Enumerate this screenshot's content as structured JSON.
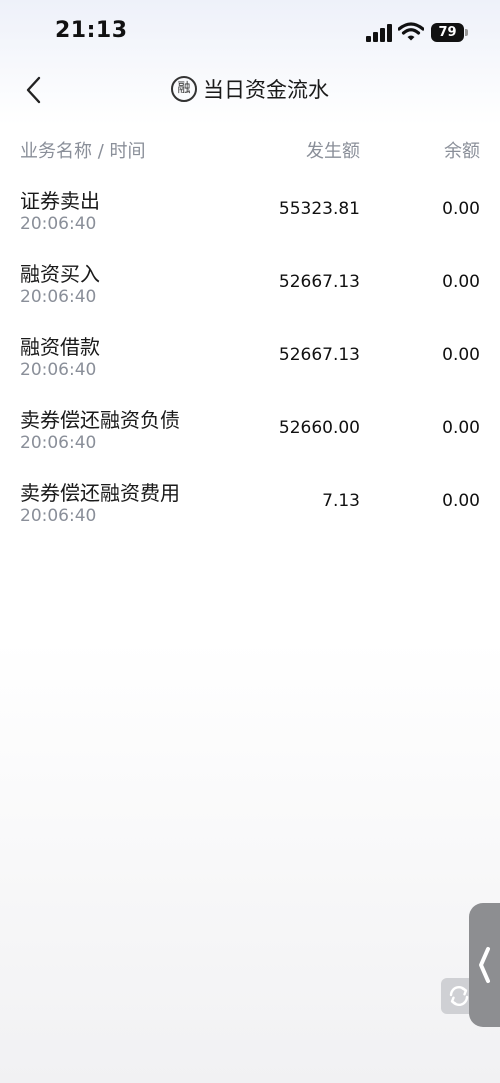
{
  "status_bar": {
    "time": "21:13",
    "battery": "79"
  },
  "nav": {
    "badge": "融",
    "title": "当日资金流水"
  },
  "table": {
    "headers": {
      "name": "业务名称 / 时间",
      "amount": "发生额",
      "balance": "余额"
    },
    "rows": [
      {
        "name": "证券卖出",
        "time": "20:06:40",
        "amount": "55323.81",
        "balance": "0.00"
      },
      {
        "name": "融资买入",
        "time": "20:06:40",
        "amount": "52667.13",
        "balance": "0.00"
      },
      {
        "name": "融资借款",
        "time": "20:06:40",
        "amount": "52667.13",
        "balance": "0.00"
      },
      {
        "name": "卖券偿还融资负债",
        "time": "20:06:40",
        "amount": "52660.00",
        "balance": "0.00"
      },
      {
        "name": "卖券偿还融资费用",
        "time": "20:06:40",
        "amount": "7.13",
        "balance": "0.00"
      }
    ]
  },
  "icons": {
    "back": "chevron-left-icon",
    "refresh": "refresh-icon",
    "side_handle": "chevron-left-icon"
  }
}
